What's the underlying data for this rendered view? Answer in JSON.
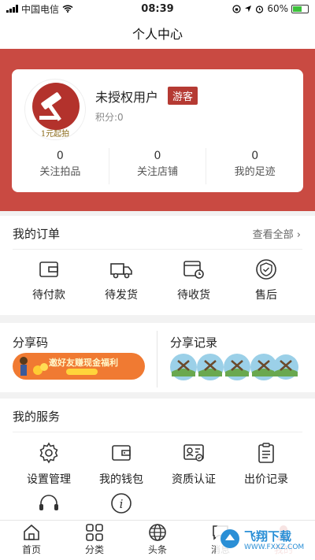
{
  "status_bar": {
    "carrier": "中国电信",
    "time": "08:39",
    "battery": "60%"
  },
  "header": {
    "title": "个人中心"
  },
  "profile": {
    "username": "未授权用户",
    "badge": "游客",
    "points": "积分:0",
    "avatar_text": "1元起拍",
    "stats": [
      {
        "value": "0",
        "label": "关注拍品"
      },
      {
        "value": "0",
        "label": "关注店铺"
      },
      {
        "value": "0",
        "label": "我的足迹"
      }
    ]
  },
  "orders": {
    "title": "我的订单",
    "view_all": "查看全部",
    "items": [
      {
        "label": "待付款",
        "icon": "wallet-icon"
      },
      {
        "label": "待发货",
        "icon": "truck-icon"
      },
      {
        "label": "待收货",
        "icon": "receive-icon"
      },
      {
        "label": "售后",
        "icon": "shield-icon"
      }
    ]
  },
  "share": {
    "code_title": "分享码",
    "banner_text": "邀好友赚现金福利",
    "record_title": "分享记录"
  },
  "services": {
    "title": "我的服务",
    "items": [
      {
        "label": "设置管理",
        "icon": "gear-icon"
      },
      {
        "label": "我的钱包",
        "icon": "purse-icon"
      },
      {
        "label": "资质认证",
        "icon": "certificate-icon"
      },
      {
        "label": "出价记录",
        "icon": "clipboard-icon"
      }
    ],
    "extra_icons": [
      "headset-icon",
      "info-icon"
    ]
  },
  "tabbar": {
    "items": [
      {
        "label": "首页",
        "icon": "home-icon"
      },
      {
        "label": "分类",
        "icon": "grid-icon"
      },
      {
        "label": "头条",
        "icon": "globe-icon"
      },
      {
        "label": "消息",
        "icon": "message-icon"
      },
      {
        "label": "我的",
        "icon": "user-icon"
      }
    ]
  },
  "watermark": {
    "text": "飞翔下载",
    "url": "WWW.FXXZ.COM"
  },
  "colors": {
    "brand_red": "#c94a42",
    "badge_red": "#b53a33",
    "banner_orange": "#f07a32"
  }
}
